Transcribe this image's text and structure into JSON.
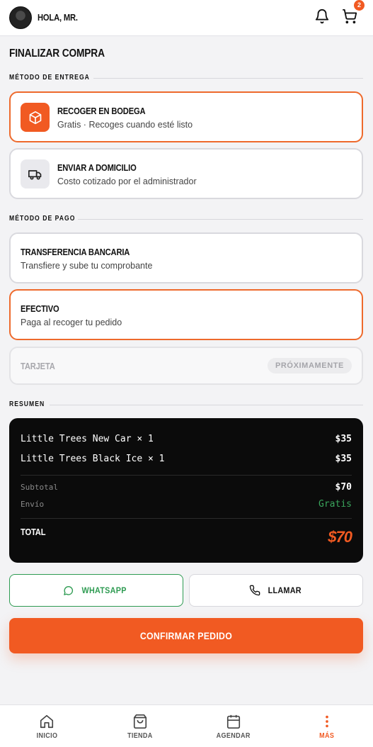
{
  "header": {
    "greeting": "HOLA, MR.",
    "cart_count": "2"
  },
  "page": {
    "title": "FINALIZAR COMPRA"
  },
  "delivery": {
    "label": "MÉTODO DE ENTREGA",
    "options": [
      {
        "title": "RECOGER EN BODEGA",
        "subtitle": "Gratis · Recoges cuando esté listo",
        "selected": true,
        "icon": "box-icon"
      },
      {
        "title": "ENVIAR A DOMICILIO",
        "subtitle": "Costo cotizado por el administrador",
        "selected": false,
        "icon": "truck-icon"
      }
    ]
  },
  "payment": {
    "label": "MÉTODO DE PAGO",
    "options": [
      {
        "title": "TRANSFERENCIA BANCARIA",
        "subtitle": "Transfiere y sube tu comprobante",
        "selected": false
      },
      {
        "title": "EFECTIVO",
        "subtitle": "Paga al recoger tu pedido",
        "selected": true
      },
      {
        "title": "TARJETA",
        "badge": "PRÓXIMAMENTE",
        "disabled": true
      }
    ]
  },
  "summary": {
    "label": "RESUMEN",
    "items": [
      {
        "name": "Little Trees New Car × 1",
        "price": "$35"
      },
      {
        "name": "Little Trees Black Ice × 1",
        "price": "$35"
      }
    ],
    "subtotal_label": "Subtotal",
    "subtotal": "$70",
    "shipping_label": "Envío",
    "shipping": "Gratis",
    "total_label": "TOTAL",
    "total": "$70"
  },
  "actions": {
    "whatsapp": "WHATSAPP",
    "call": "LLAMAR",
    "confirm": "CONFIRMAR PEDIDO"
  },
  "nav": [
    {
      "label": "INICIO",
      "icon": "home-icon"
    },
    {
      "label": "TIENDA",
      "icon": "shopping-bag-icon"
    },
    {
      "label": "AGENDAR",
      "icon": "calendar-icon"
    },
    {
      "label": "MÁS",
      "icon": "more-vertical-icon",
      "active": true
    }
  ],
  "colors": {
    "accent": "#f15a22",
    "success": "#2e9b52",
    "dark": "#0b0b0b"
  }
}
